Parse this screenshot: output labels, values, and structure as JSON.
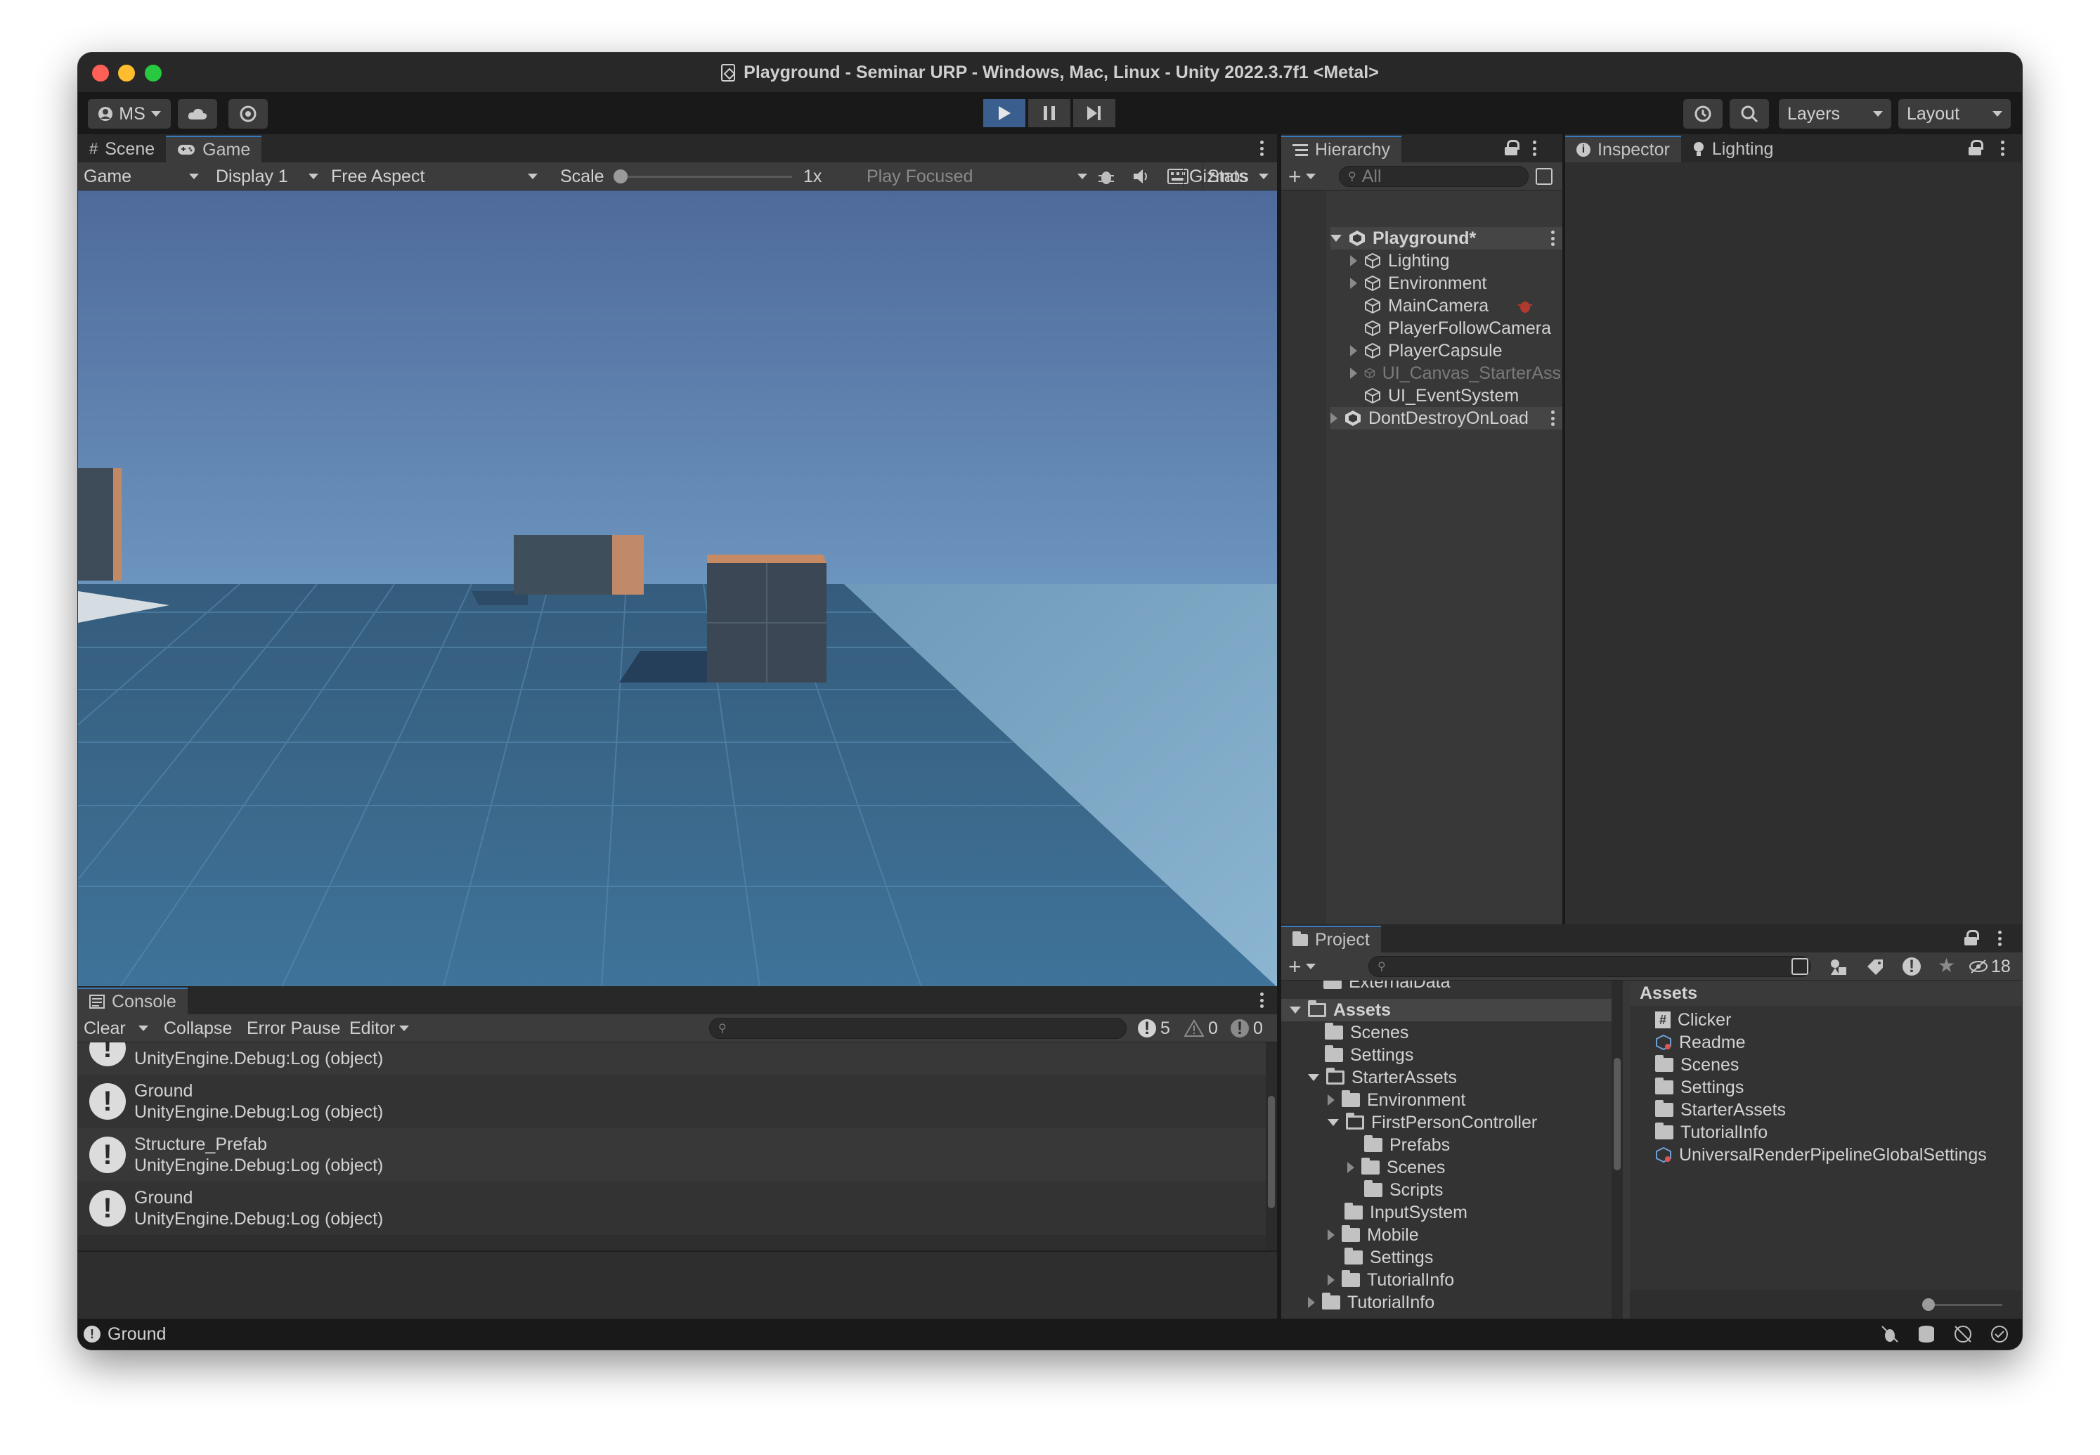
{
  "window": {
    "title": "Playground - Seminar URP - Windows, Mac, Linux - Unity 2022.3.7f1 <Metal>"
  },
  "toolbar": {
    "account_label": "MS",
    "layers_label": "Layers",
    "layout_label": "Layout"
  },
  "game_panel": {
    "tabs": [
      "Scene",
      "Game"
    ],
    "view_dropdown": "Game",
    "display_dropdown": "Display 1",
    "aspect_dropdown": "Free Aspect",
    "scale_label": "Scale",
    "scale_value": "1x",
    "play_mode": "Play Focused",
    "stats_label": "Stats",
    "gizmos_label": "Gizmos"
  },
  "hierarchy": {
    "tab": "Hierarchy",
    "search_placeholder": "All",
    "scene_root": "Playground*",
    "items": [
      "Lighting",
      "Environment",
      "MainCamera",
      "PlayerFollowCamera",
      "PlayerCapsule",
      "UI_Canvas_StarterAss",
      "UI_EventSystem"
    ],
    "dont_destroy": "DontDestroyOnLoad"
  },
  "inspector": {
    "tabs": [
      "Inspector",
      "Lighting"
    ]
  },
  "console": {
    "tab": "Console",
    "buttons": {
      "clear": "Clear",
      "collapse": "Collapse",
      "error_pause": "Error Pause",
      "editor": "Editor"
    },
    "counts": {
      "logs": "5",
      "warnings": "0",
      "errors": "0"
    },
    "partial_first": "UnityEngine.Debug:Log (object)",
    "entries": [
      {
        "title": "Ground",
        "detail": "UnityEngine.Debug:Log (object)"
      },
      {
        "title": "Structure_Prefab",
        "detail": "UnityEngine.Debug:Log (object)"
      },
      {
        "title": "Ground",
        "detail": "UnityEngine.Debug:Log (object)"
      }
    ]
  },
  "project": {
    "tab": "Project",
    "hidden_count": "18",
    "tree_cut_top": "ExternalData",
    "tree": {
      "assets": "Assets",
      "scenes": "Scenes",
      "settings": "Settings",
      "starter_assets": "StarterAssets",
      "environment": "Environment",
      "fpc": "FirstPersonController",
      "prefabs": "Prefabs",
      "fpc_scenes": "Scenes",
      "scripts": "Scripts",
      "input_system": "InputSystem",
      "mobile": "Mobile",
      "sa_settings": "Settings",
      "tutorial_info": "TutorialInfo",
      "cut_bottom": "TutorialInfo"
    },
    "breadcrumb": "Assets",
    "assets": [
      "Clicker",
      "Readme",
      "Scenes",
      "Settings",
      "StarterAssets",
      "TutorialInfo",
      "UniversalRenderPipelineGlobalSettings"
    ]
  },
  "status": {
    "message": "Ground"
  },
  "colors": {
    "accent": "#3a79bb",
    "play_active": "#3a5f8f",
    "sky_top": "#4e6f9f",
    "ground": "#3a6b8e"
  }
}
